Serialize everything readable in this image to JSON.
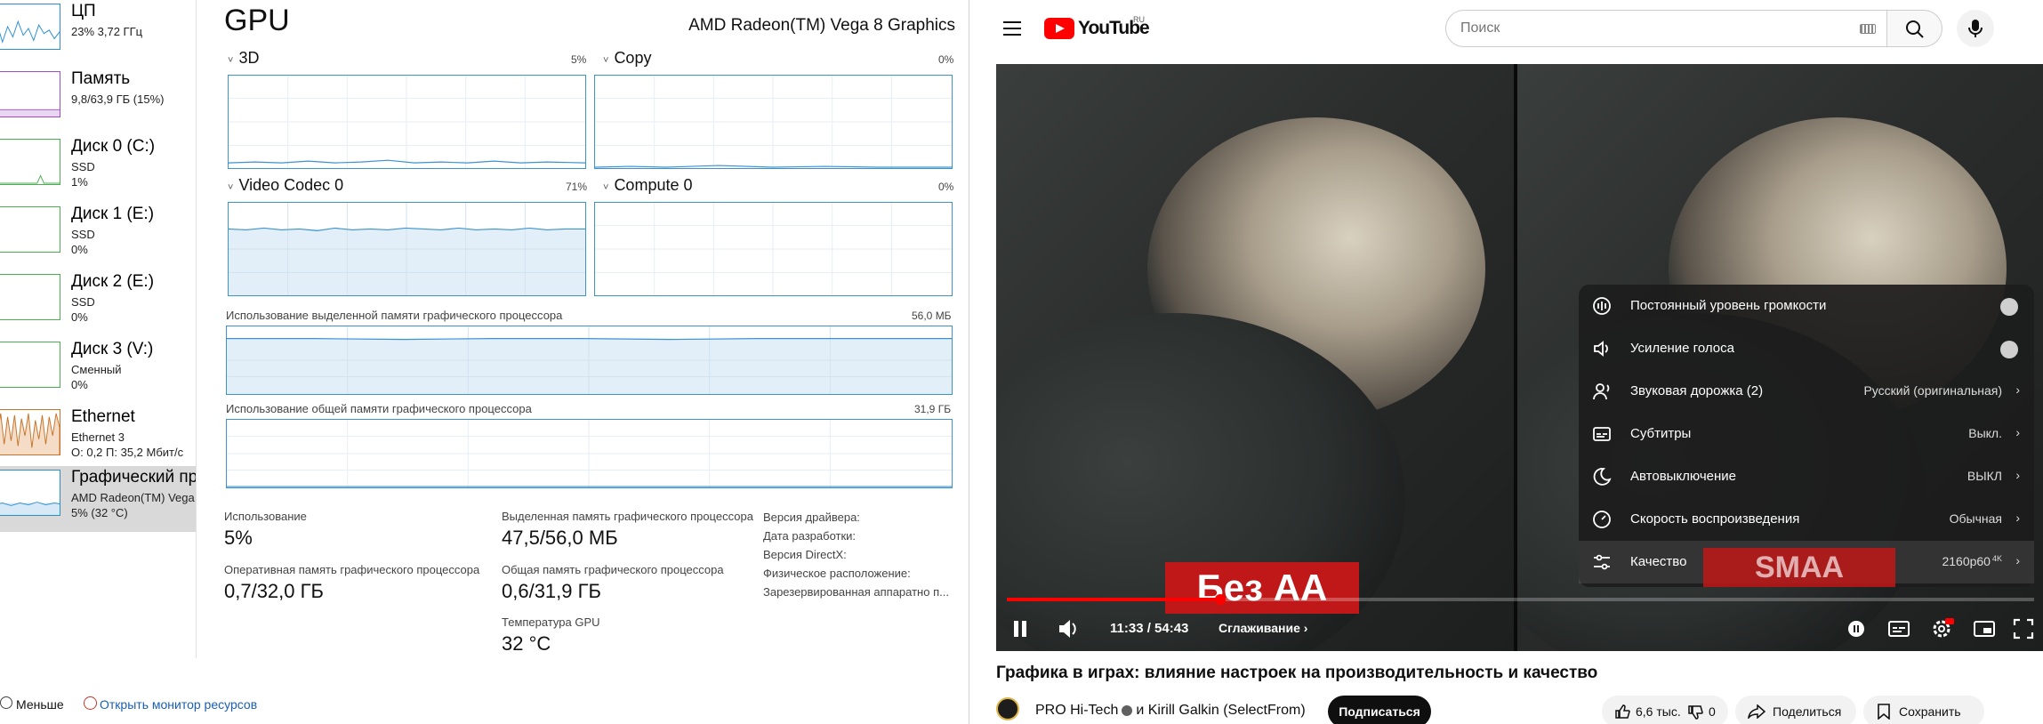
{
  "task_manager": {
    "sidebar": [
      {
        "title": "ЦП",
        "sub1": "23%  3,72 ГГц",
        "sub2": ""
      },
      {
        "title": "Память",
        "sub1": "9,8/63,9 ГБ (15%)",
        "sub2": ""
      },
      {
        "title": "Диск 0 (C:)",
        "sub1": "SSD",
        "sub2": "1%"
      },
      {
        "title": "Диск 1 (E:)",
        "sub1": "SSD",
        "sub2": "0%"
      },
      {
        "title": "Диск 2 (E:)",
        "sub1": "SSD",
        "sub2": "0%"
      },
      {
        "title": "Диск 3 (V:)",
        "sub1": "Сменный",
        "sub2": "0%"
      },
      {
        "title": "Ethernet",
        "sub1": "Ethernet 3",
        "sub2": "О: 0,2  П: 35,2 Мбит/с"
      },
      {
        "title": "Графический пр",
        "sub1": "AMD Radeon(TM) Vega",
        "sub2": "5%  (32 °C)"
      }
    ],
    "title": "GPU",
    "gpu_name": "AMD Radeon(TM) Vega 8 Graphics",
    "engines": [
      {
        "name": "3D",
        "pct": "5%"
      },
      {
        "name": "Copy",
        "pct": "0%"
      },
      {
        "name": "Video Codec 0",
        "pct": "71%"
      },
      {
        "name": "Compute 0",
        "pct": "0%"
      }
    ],
    "dedicated_mem_label": "Использование выделенной памяти графического процессора",
    "dedicated_mem_max": "56,0 МБ",
    "shared_mem_label": "Использование общей памяти графического процессора",
    "shared_mem_max": "31,9 ГБ",
    "stats": {
      "usage_label": "Использование",
      "usage_value": "5%",
      "dedicated_label": "Выделенная память графического процессора",
      "dedicated_value": "47,5/56,0 МБ",
      "gpu_ram_label": "Оперативная память графического процессора",
      "gpu_ram_value": "0,7/32,0 ГБ",
      "shared_label": "Общая память графического процессора",
      "shared_value": "0,6/31,9 ГБ",
      "temp_label": "Температура GPU",
      "temp_value": "32 °C"
    },
    "info": [
      "Версия драйвера:",
      "Дата разработки:",
      "Версия DirectX:",
      "Физическое расположение:",
      "Зарезервированная аппаратно п..."
    ],
    "footer": {
      "less": "Меньше",
      "resmon": "Открыть монитор ресурсов"
    }
  },
  "youtube": {
    "logo_text": "YouTube",
    "region": "RU",
    "search_placeholder": "Поиск",
    "video_overlay_left": "Без АА",
    "video_overlay_right": "SMAA",
    "settings": [
      {
        "label": "Постоянный уровень громкости",
        "value": "",
        "type": "toggle",
        "icon": "volume-stable-icon"
      },
      {
        "label": "Усиление голоса",
        "value": "",
        "type": "toggle",
        "icon": "voice-boost-icon"
      },
      {
        "label": "Звуковая дорожка (2)",
        "value": "Русский (оригинальная)",
        "type": "menu",
        "icon": "audio-track-icon"
      },
      {
        "label": "Субтитры",
        "value": "Выкл.",
        "type": "menu",
        "icon": "subtitles-icon"
      },
      {
        "label": "Автовыключение",
        "value": "ВЫКЛ",
        "type": "menu",
        "icon": "sleep-timer-icon"
      },
      {
        "label": "Скорость воспроизведения",
        "value": "Обычная",
        "type": "menu",
        "icon": "playback-speed-icon"
      },
      {
        "label": "Качество",
        "value": "2160p60",
        "value_sup": "4K",
        "type": "menu",
        "icon": "quality-icon"
      }
    ],
    "progress_fraction": 0.208,
    "time": "11:33 / 54:43",
    "chapter": "Сглаживание",
    "video_title": "Графика в играх: влияние настроек на производительность и качество",
    "channel": "PRO Hi-Tech",
    "collab": "и Kirill Galkin (SelectFrom)",
    "subscribe": "Подписаться",
    "likes": "6,6 тыс.",
    "dislikes": "0",
    "share": "Поделиться",
    "save": "Сохранить",
    "colors": {
      "brand_red": "#ff0000",
      "graph_blue": "#3c93cf"
    }
  }
}
